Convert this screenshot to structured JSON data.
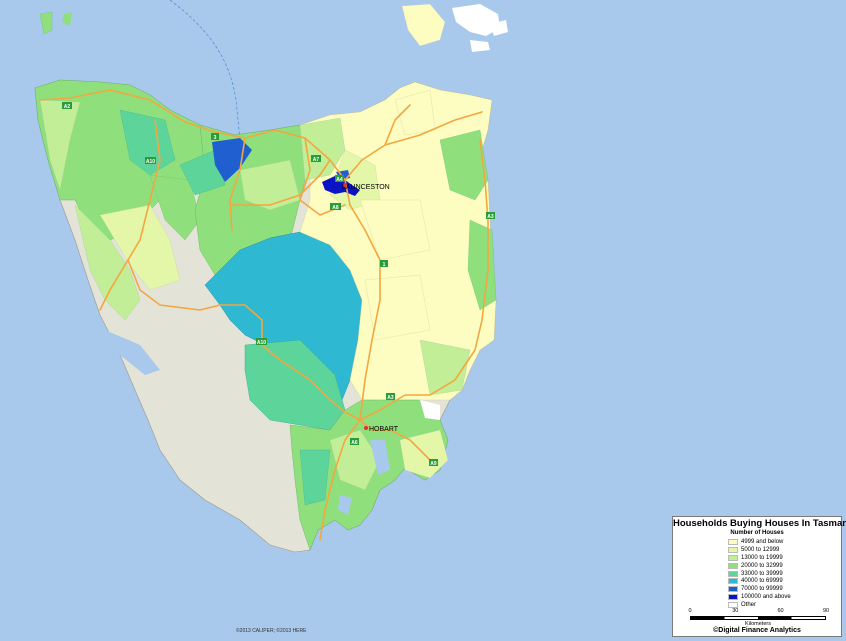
{
  "legend": {
    "title": "Households Buying Houses In Tasmania",
    "subtitle": "Number of Houses",
    "items": [
      {
        "label": "4999 and below",
        "color": "#fdfdc2"
      },
      {
        "label": "5000 to 12999",
        "color": "#e4f7a8"
      },
      {
        "label": "13000 to 19999",
        "color": "#c3ee98"
      },
      {
        "label": "20000 to 32999",
        "color": "#8fe07d"
      },
      {
        "label": "33000 to 39999",
        "color": "#5dd59a"
      },
      {
        "label": "40000 to 69999",
        "color": "#2eb8d1"
      },
      {
        "label": "70000 to 99999",
        "color": "#1f5fd0"
      },
      {
        "label": "100000 and above",
        "color": "#0c13c4"
      },
      {
        "label": "Other",
        "color": "#ffffff"
      }
    ]
  },
  "scale": {
    "ticks": [
      "0",
      "30",
      "60",
      "90"
    ],
    "units": "Kilometers"
  },
  "credit": "©Digital Finance Analytics",
  "attribution": "©2013 CALIPER; ©2013 HERE",
  "cities": {
    "launceston": "LAUNCESTON",
    "hobart": "HOBART"
  },
  "roads": [
    "A2",
    "3",
    "A10",
    "A7",
    "A4",
    "A3",
    "1",
    "A8",
    "A10",
    "A3",
    "A6",
    "A9"
  ],
  "colors": {
    "sea": "#a8c8ec",
    "road": "#f4a640",
    "wilderness": "#e3e3d7"
  }
}
